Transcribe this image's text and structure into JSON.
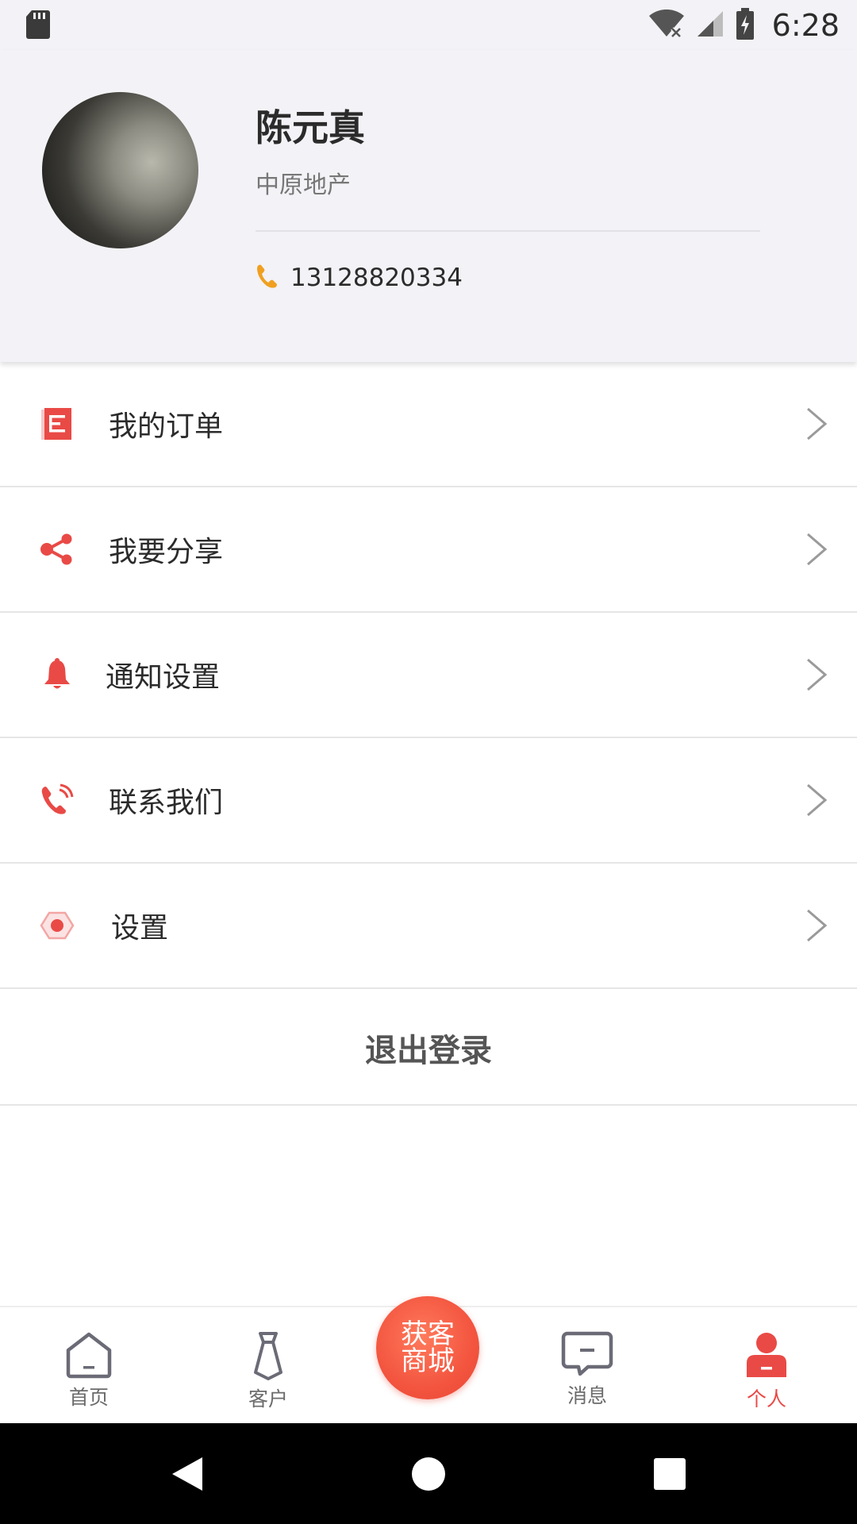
{
  "status_bar": {
    "time": "6:28",
    "icons": [
      "sd-card-icon",
      "wifi-off-icon",
      "signal-icon",
      "battery-charging-icon"
    ]
  },
  "profile": {
    "name": "陈元真",
    "company": "中原地产",
    "phone": "13128820334"
  },
  "menu": {
    "items": [
      {
        "label": "我的订单",
        "icon": "order-list-icon"
      },
      {
        "label": "我要分享",
        "icon": "share-icon"
      },
      {
        "label": "通知设置",
        "icon": "bell-icon"
      },
      {
        "label": "联系我们",
        "icon": "phone-call-icon"
      },
      {
        "label": "设置",
        "icon": "settings-icon"
      }
    ],
    "logout_label": "退出登录"
  },
  "bottom_nav": {
    "items": [
      {
        "label": "首页",
        "icon": "home-icon"
      },
      {
        "label": "客户",
        "icon": "tie-icon"
      },
      {
        "label": "消息",
        "icon": "message-icon"
      },
      {
        "label": "个人",
        "icon": "person-icon",
        "active": true
      }
    ],
    "center_button": {
      "line1": "获客",
      "line2": "商城"
    }
  },
  "colors": {
    "accent": "#e94a46",
    "phone_icon": "#f0a020",
    "header_bg": "#f3f2f6"
  }
}
